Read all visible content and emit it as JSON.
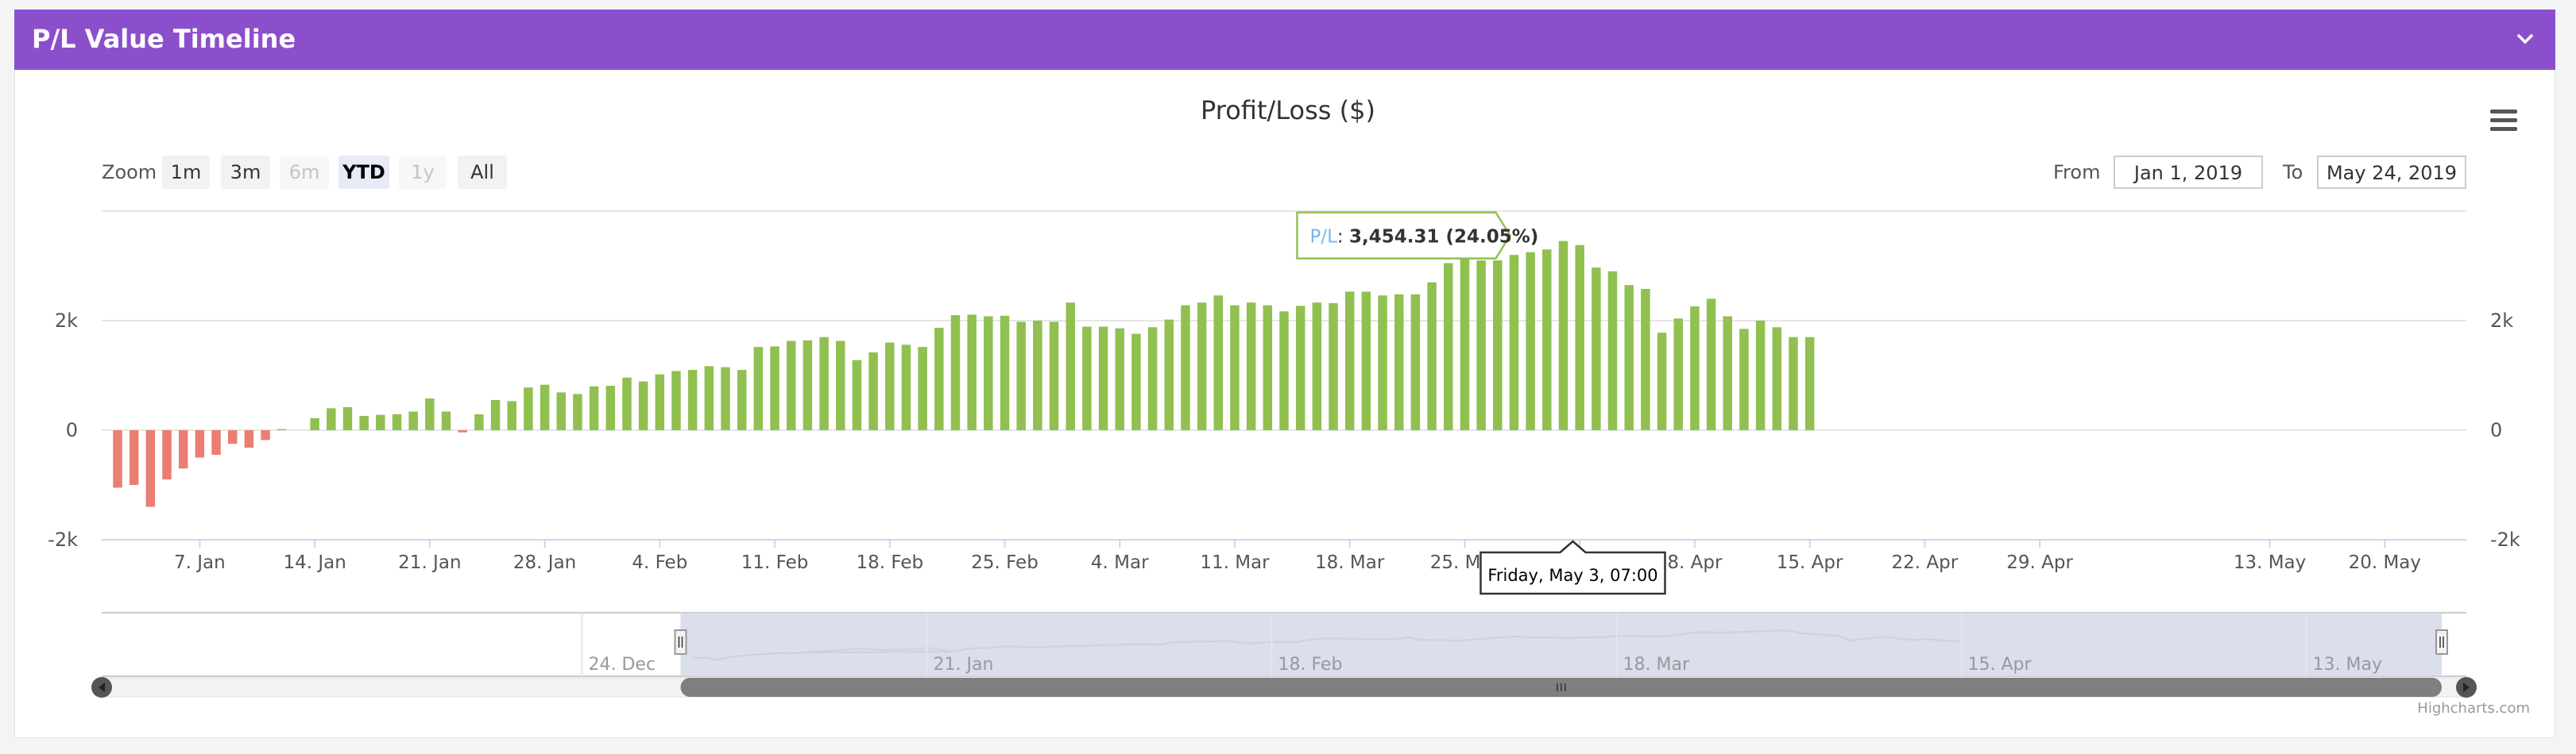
{
  "panel": {
    "title": "P/L Value Timeline"
  },
  "colors": {
    "header": "#8c4fcc",
    "positive": "#90c04f",
    "negative": "#ea7e73",
    "navigator_mask": "#d3d8ea",
    "scrollbar": "#7f7f7f"
  },
  "icons": {
    "collapse": "chevron-down-icon",
    "menu": "hamburger-menu-icon"
  },
  "range_selector": {
    "zoom_label": "Zoom",
    "buttons": [
      {
        "label": "1m",
        "state": "normal"
      },
      {
        "label": "3m",
        "state": "normal"
      },
      {
        "label": "6m",
        "state": "disabled"
      },
      {
        "label": "YTD",
        "state": "selected"
      },
      {
        "label": "1y",
        "state": "disabled"
      },
      {
        "label": "All",
        "state": "normal"
      }
    ],
    "from_label": "From",
    "from_value": "Jan 1, 2019",
    "to_label": "To",
    "to_value": "May 24, 2019"
  },
  "tooltip": {
    "series": "P/L",
    "value": "3,454.31 (24.05%)",
    "date": "Friday, May 3, 07:00"
  },
  "credits": "Highcharts.com",
  "chart_data": {
    "type": "bar",
    "title": "Profit/Loss ($)",
    "ylim": [
      -2000,
      4000
    ],
    "y_ticks": [
      -2000,
      0,
      2000
    ],
    "y_tick_labels": [
      "-2k",
      "0",
      "2k"
    ],
    "grid": true,
    "legend": "none",
    "x_range": [
      "2019-01-02",
      "2019-05-24"
    ],
    "x_tick_labels": [
      {
        "date": "2019-01-07",
        "label": "7. Jan"
      },
      {
        "date": "2019-01-14",
        "label": "14. Jan"
      },
      {
        "date": "2019-01-21",
        "label": "21. Jan"
      },
      {
        "date": "2019-01-28",
        "label": "28. Jan"
      },
      {
        "date": "2019-02-04",
        "label": "4. Feb"
      },
      {
        "date": "2019-02-11",
        "label": "11. Feb"
      },
      {
        "date": "2019-02-18",
        "label": "18. Feb"
      },
      {
        "date": "2019-02-25",
        "label": "25. Feb"
      },
      {
        "date": "2019-03-04",
        "label": "4. Mar"
      },
      {
        "date": "2019-03-11",
        "label": "11. Mar"
      },
      {
        "date": "2019-03-18",
        "label": "18. Mar"
      },
      {
        "date": "2019-03-25",
        "label": "25. Mar"
      },
      {
        "date": "2019-04-01",
        "label": "1. Apr"
      },
      {
        "date": "2019-04-08",
        "label": "8. Apr"
      },
      {
        "date": "2019-04-15",
        "label": "15. Apr"
      },
      {
        "date": "2019-04-22",
        "label": "22. Apr"
      },
      {
        "date": "2019-04-29",
        "label": "29. Apr"
      },
      {
        "date": "2019-05-13",
        "label": "13. May"
      },
      {
        "date": "2019-05-20",
        "label": "20. May"
      }
    ],
    "series": [
      {
        "name": "P/L",
        "points": [
          {
            "date": "2019-01-02",
            "value": -1050
          },
          {
            "date": "2019-01-03",
            "value": -1000
          },
          {
            "date": "2019-01-04",
            "value": -1400
          },
          {
            "date": "2019-01-05",
            "value": -900
          },
          {
            "date": "2019-01-06",
            "value": -700
          },
          {
            "date": "2019-01-07",
            "value": -500
          },
          {
            "date": "2019-01-08",
            "value": -450
          },
          {
            "date": "2019-01-09",
            "value": -250
          },
          {
            "date": "2019-01-10",
            "value": -320
          },
          {
            "date": "2019-01-11",
            "value": -180
          },
          {
            "date": "2019-01-12",
            "value": 20
          },
          {
            "date": "2019-01-14",
            "value": 220
          },
          {
            "date": "2019-01-15",
            "value": 400
          },
          {
            "date": "2019-01-16",
            "value": 420
          },
          {
            "date": "2019-01-17",
            "value": 260
          },
          {
            "date": "2019-01-18",
            "value": 280
          },
          {
            "date": "2019-01-19",
            "value": 290
          },
          {
            "date": "2019-01-20",
            "value": 340
          },
          {
            "date": "2019-01-21",
            "value": 580
          },
          {
            "date": "2019-01-22",
            "value": 340
          },
          {
            "date": "2019-01-23",
            "value": -40
          },
          {
            "date": "2019-01-24",
            "value": 290
          },
          {
            "date": "2019-01-25",
            "value": 550
          },
          {
            "date": "2019-01-26",
            "value": 530
          },
          {
            "date": "2019-01-27",
            "value": 780
          },
          {
            "date": "2019-01-28",
            "value": 830
          },
          {
            "date": "2019-01-29",
            "value": 690
          },
          {
            "date": "2019-01-30",
            "value": 660
          },
          {
            "date": "2019-01-31",
            "value": 800
          },
          {
            "date": "2019-02-01",
            "value": 810
          },
          {
            "date": "2019-02-02",
            "value": 960
          },
          {
            "date": "2019-02-03",
            "value": 890
          },
          {
            "date": "2019-02-04",
            "value": 1020
          },
          {
            "date": "2019-02-05",
            "value": 1080
          },
          {
            "date": "2019-02-06",
            "value": 1100
          },
          {
            "date": "2019-02-07",
            "value": 1170
          },
          {
            "date": "2019-02-08",
            "value": 1150
          },
          {
            "date": "2019-02-09",
            "value": 1100
          },
          {
            "date": "2019-02-10",
            "value": 1520
          },
          {
            "date": "2019-02-11",
            "value": 1530
          },
          {
            "date": "2019-02-12",
            "value": 1630
          },
          {
            "date": "2019-02-13",
            "value": 1640
          },
          {
            "date": "2019-02-14",
            "value": 1700
          },
          {
            "date": "2019-02-15",
            "value": 1630
          },
          {
            "date": "2019-02-16",
            "value": 1280
          },
          {
            "date": "2019-02-17",
            "value": 1420
          },
          {
            "date": "2019-02-18",
            "value": 1600
          },
          {
            "date": "2019-02-19",
            "value": 1560
          },
          {
            "date": "2019-02-20",
            "value": 1520
          },
          {
            "date": "2019-02-21",
            "value": 1870
          },
          {
            "date": "2019-02-22",
            "value": 2100
          },
          {
            "date": "2019-02-23",
            "value": 2110
          },
          {
            "date": "2019-02-24",
            "value": 2080
          },
          {
            "date": "2019-02-25",
            "value": 2090
          },
          {
            "date": "2019-02-26",
            "value": 1980
          },
          {
            "date": "2019-02-27",
            "value": 2000
          },
          {
            "date": "2019-02-28",
            "value": 1980
          },
          {
            "date": "2019-03-01",
            "value": 2330
          },
          {
            "date": "2019-03-02",
            "value": 1890
          },
          {
            "date": "2019-03-03",
            "value": 1890
          },
          {
            "date": "2019-03-04",
            "value": 1860
          },
          {
            "date": "2019-03-05",
            "value": 1760
          },
          {
            "date": "2019-03-06",
            "value": 1880
          },
          {
            "date": "2019-03-07",
            "value": 2020
          },
          {
            "date": "2019-03-08",
            "value": 2280
          },
          {
            "date": "2019-03-09",
            "value": 2330
          },
          {
            "date": "2019-03-10",
            "value": 2460
          },
          {
            "date": "2019-03-11",
            "value": 2280
          },
          {
            "date": "2019-03-12",
            "value": 2330
          },
          {
            "date": "2019-03-13",
            "value": 2280
          },
          {
            "date": "2019-03-14",
            "value": 2170
          },
          {
            "date": "2019-03-15",
            "value": 2270
          },
          {
            "date": "2019-03-16",
            "value": 2330
          },
          {
            "date": "2019-03-17",
            "value": 2320
          },
          {
            "date": "2019-03-18",
            "value": 2530
          },
          {
            "date": "2019-03-19",
            "value": 2530
          },
          {
            "date": "2019-03-20",
            "value": 2460
          },
          {
            "date": "2019-03-21",
            "value": 2480
          },
          {
            "date": "2019-03-22",
            "value": 2480
          },
          {
            "date": "2019-03-23",
            "value": 2700
          },
          {
            "date": "2019-03-24",
            "value": 3050
          },
          {
            "date": "2019-03-25",
            "value": 3150
          },
          {
            "date": "2019-03-26",
            "value": 3100
          },
          {
            "date": "2019-03-27",
            "value": 3100
          },
          {
            "date": "2019-03-28",
            "value": 3200
          },
          {
            "date": "2019-03-29",
            "value": 3250
          },
          {
            "date": "2019-03-30",
            "value": 3300
          },
          {
            "date": "2019-03-31",
            "value": 3454.31
          },
          {
            "date": "2019-04-01",
            "value": 3380
          },
          {
            "date": "2019-04-02",
            "value": 2970
          },
          {
            "date": "2019-04-03",
            "value": 2900
          },
          {
            "date": "2019-04-04",
            "value": 2650
          },
          {
            "date": "2019-04-05",
            "value": 2580
          },
          {
            "date": "2019-04-06",
            "value": 1780
          },
          {
            "date": "2019-04-07",
            "value": 2040
          },
          {
            "date": "2019-04-08",
            "value": 2260
          },
          {
            "date": "2019-04-09",
            "value": 2400
          },
          {
            "date": "2019-04-10",
            "value": 2080
          },
          {
            "date": "2019-04-11",
            "value": 1850
          },
          {
            "date": "2019-04-12",
            "value": 2000
          },
          {
            "date": "2019-04-13",
            "value": 1880
          },
          {
            "date": "2019-04-14",
            "value": 1700
          },
          {
            "date": "2019-04-15",
            "value": 1700
          }
        ]
      }
    ],
    "navigator": {
      "x_range": [
        "2018-11-15",
        "2019-05-26"
      ],
      "selected_range": [
        "2019-01-01",
        "2019-05-24"
      ],
      "tick_labels": [
        {
          "date": "2018-12-24",
          "label": "24. Dec"
        },
        {
          "date": "2019-01-21",
          "label": "21. Jan"
        },
        {
          "date": "2019-02-18",
          "label": "18. Feb"
        },
        {
          "date": "2019-03-18",
          "label": "18. Mar"
        },
        {
          "date": "2019-04-15",
          "label": "15. Apr"
        },
        {
          "date": "2019-05-13",
          "label": "13. May"
        }
      ]
    }
  }
}
